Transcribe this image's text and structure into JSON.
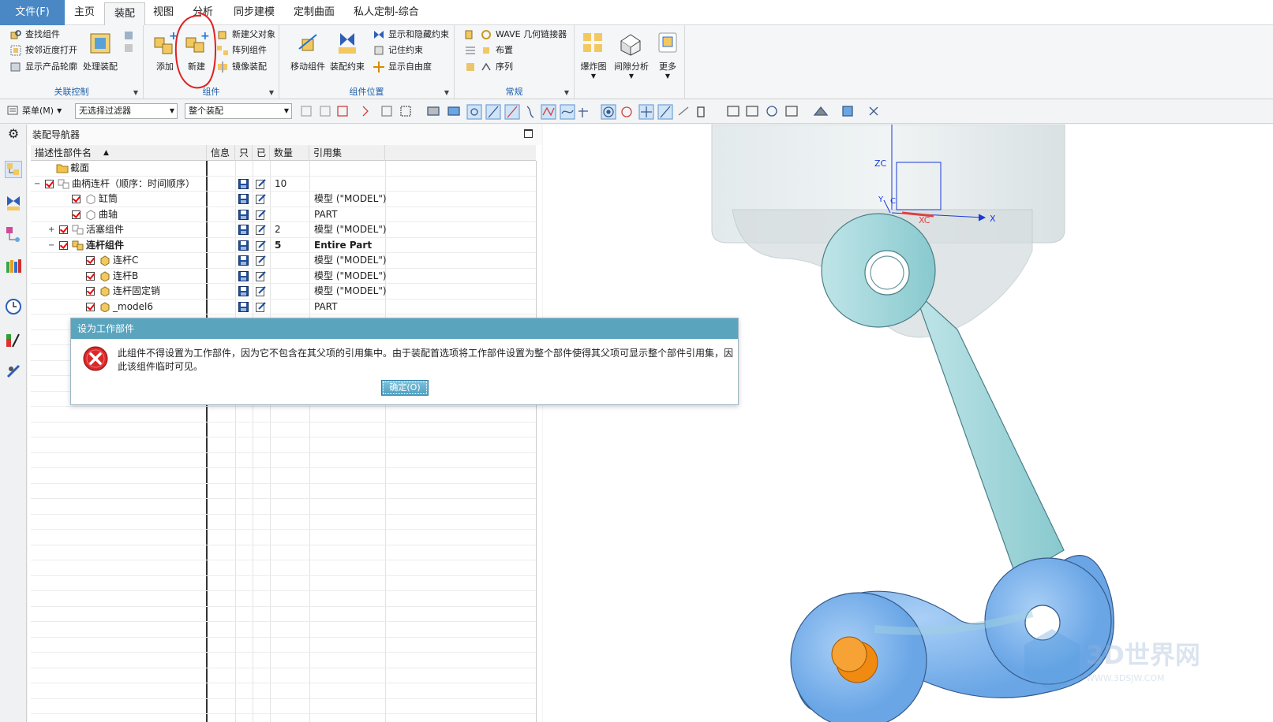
{
  "menu": {
    "file_tab": "文件(F)",
    "tabs": [
      "主页",
      "装配",
      "视图",
      "分析",
      "同步建模",
      "定制曲面",
      "私人定制-综合"
    ]
  },
  "ribbon": {
    "group1": {
      "label": "关联控制",
      "items": [
        "查找组件",
        "按邻近度打开",
        "显示产品轮廓"
      ],
      "big": "处理装配"
    },
    "group2": {
      "label": "组件",
      "add": "添加",
      "new": "新建",
      "items": [
        "新建父对象",
        "阵列组件",
        "镜像装配"
      ]
    },
    "group3": {
      "label": "组件位置",
      "move": "移动组件",
      "constraint": "装配约束",
      "items": [
        "显示和隐藏约束",
        "记住约束",
        "显示自由度"
      ]
    },
    "group4": {
      "label": "常规",
      "items": [
        "WAVE 几何链接器",
        "布置",
        "序列"
      ]
    },
    "group5": {
      "explode": "爆炸图",
      "gap": "间隙分析",
      "more": "更多"
    }
  },
  "toolbar2": {
    "menu_label": "菜单(M)",
    "filter": "无选择过滤器",
    "scope": "整个装配"
  },
  "navigator": {
    "title": "装配导航器",
    "columns": [
      "描述性部件名",
      "信息",
      "只",
      "已",
      "数量",
      "引用集"
    ],
    "rows": [
      {
        "name": "截面",
        "qty": "",
        "ref": ""
      },
      {
        "name": "曲柄连杆（顺序：时间顺序）",
        "qty": "10",
        "ref": ""
      },
      {
        "name": "缸筒",
        "qty": "",
        "ref": "模型 (\"MODEL\")"
      },
      {
        "name": "曲轴",
        "qty": "",
        "ref": "PART"
      },
      {
        "name": "活塞组件",
        "qty": "2",
        "ref": "模型 (\"MODEL\")"
      },
      {
        "name": "连杆组件",
        "qty": "5",
        "ref": "Entire Part"
      },
      {
        "name": "连杆C",
        "qty": "",
        "ref": "模型 (\"MODEL\")"
      },
      {
        "name": "连杆B",
        "qty": "",
        "ref": "模型 (\"MODEL\")"
      },
      {
        "name": "连杆固定销",
        "qty": "",
        "ref": "模型 (\"MODEL\")"
      },
      {
        "name": "_model6",
        "qty": "",
        "ref": "PART"
      }
    ]
  },
  "dialog": {
    "title": "设为工作部件",
    "message": "此组件不得设置为工作部件，因为它不包含在其父项的引用集中。由于装配首选项将工作部件设置为整个部件使得其父项可显示整个部件引用集，因此该组件临时可见。",
    "ok": "确定(O)"
  },
  "viewport": {
    "axis_z": "ZC",
    "axis_x": "X",
    "axis_xc": "XC",
    "axis_y": "Y",
    "axis_c": "C",
    "watermark": "3D世界网",
    "watermark_url": "WWW.3DSJW.COM"
  },
  "colors": {
    "file_tab": "#4a87c5",
    "dialog_title": "#5aa4be",
    "part": "#a8dadd",
    "pin": "#f39a12"
  }
}
